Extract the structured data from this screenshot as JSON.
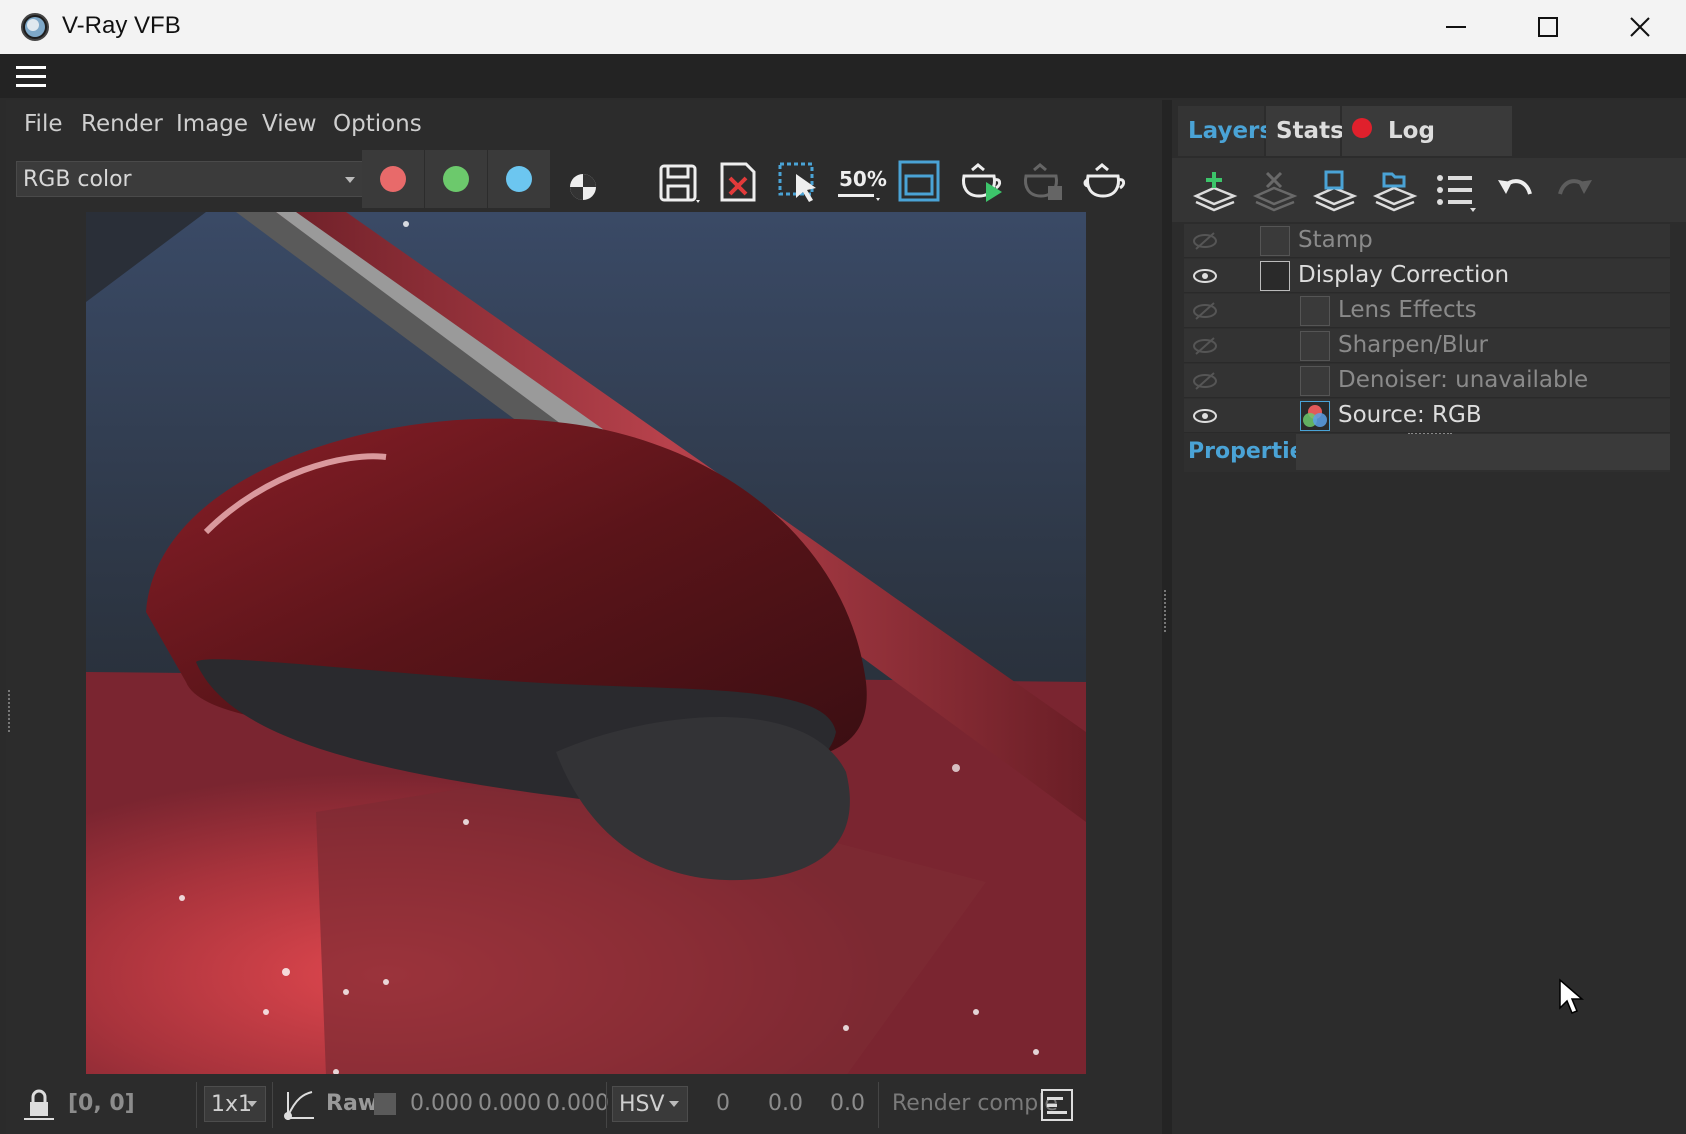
{
  "window": {
    "title": "V-Ray VFB"
  },
  "menu": {
    "items": [
      "File",
      "Render",
      "Image",
      "View",
      "Options"
    ]
  },
  "toolbar": {
    "channel_value": "RGB color",
    "channel_buttons": [
      {
        "name": "red-channel",
        "color": "#e86a6a"
      },
      {
        "name": "green-channel",
        "color": "#6cc96c"
      },
      {
        "name": "blue-channel",
        "color": "#6cc6f0"
      }
    ],
    "zoom_label": "50%"
  },
  "tabs": {
    "layers": "Layers",
    "stats": "Stats",
    "log": "Log"
  },
  "layers": [
    {
      "label": "Stamp",
      "visible": false,
      "indent": 0,
      "icon": "stamp-icon"
    },
    {
      "label": "Display Correction",
      "visible": true,
      "indent": 0,
      "icon": "curve-icon"
    },
    {
      "label": "Lens Effects",
      "visible": false,
      "indent": 1,
      "icon": "lens-effects-icon"
    },
    {
      "label": "Sharpen/Blur",
      "visible": false,
      "indent": 1,
      "icon": "sharpen-icon"
    },
    {
      "label": "Denoiser: unavailable",
      "visible": false,
      "indent": 1,
      "icon": "denoiser-icon"
    },
    {
      "label": "Source: RGB",
      "visible": true,
      "indent": 1,
      "icon": "rgb-source-icon"
    }
  ],
  "properties": {
    "label": "Properties"
  },
  "status": {
    "coords": "[0, 0]",
    "sample_size": "1x1",
    "raw_label": "Raw",
    "r": "0.000",
    "g": "0.000",
    "b": "0.000",
    "color_space": "HSV",
    "h": "0",
    "s": "0.0",
    "v": "0.0",
    "message": "Render comple"
  },
  "colors": {
    "accent": "#4aa3d6",
    "log_indicator": "#e0202c"
  }
}
